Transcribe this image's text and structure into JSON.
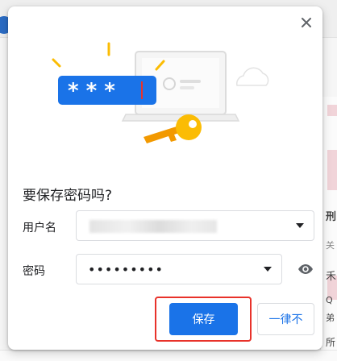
{
  "dialog": {
    "title": "要保存密码吗?",
    "username_label": "用户名",
    "password_label": "密码",
    "password_masked": "•••••••••",
    "save_label": "保存",
    "never_label": "一律不"
  },
  "illustration": {
    "password_badge": "* * *"
  },
  "background": {
    "right_text": [
      "刑",
      "关",
      "禾",
      "Q",
      "弟",
      "所"
    ]
  },
  "colors": {
    "accent": "#1a73e8",
    "annotation": "#e8322a",
    "key": "#fbbc04",
    "badge": "#1a73e8"
  },
  "icons": [
    "close-icon",
    "caret-down-icon",
    "eye-icon",
    "key-icon",
    "laptop-icon",
    "cloud-icon"
  ]
}
